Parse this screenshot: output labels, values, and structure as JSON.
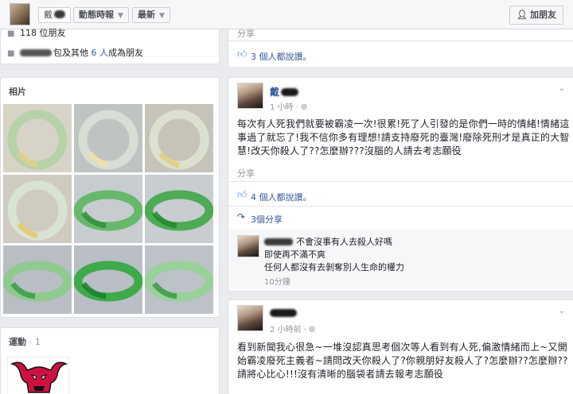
{
  "topbar": {
    "name_prefix": "戴",
    "timeline_label": "動態時報",
    "recent_label": "最新",
    "add_friend_label": "加朋友"
  },
  "friends": {
    "count_text": "118 位朋友",
    "mutual_suffix_1": "包及其他",
    "mutual_count": "6 人",
    "mutual_suffix_2": "成為朋友"
  },
  "top_post": {
    "share_label": "分享",
    "likes_count": "3",
    "likes_text": "個人都說讚。"
  },
  "photos": {
    "title": "相片",
    "tiles": [
      {
        "bg": "#d7d3c6",
        "band": "#b7d2a8",
        "accent": "#e6cf8a"
      },
      {
        "bg": "#bfc4c3",
        "band": "#d6ded6",
        "accent": "#f0e2a2"
      },
      {
        "bg": "#c6c4b8",
        "band": "#dbe0cf",
        "accent": "#e0cf7c"
      },
      {
        "bg": "#cfcbc1",
        "band": "#d9e3d3",
        "accent": "#e2c86a"
      },
      {
        "bg": "#c7ccd1",
        "band": "#67b86a",
        "accent": "#2f8f3a"
      },
      {
        "bg": "#c8cdd2",
        "band": "#4faa55",
        "accent": "#1f8a2e"
      },
      {
        "bg": "#b8bec4",
        "band": "#8fca8f",
        "accent": "#3a9d45"
      },
      {
        "bg": "#b9bfc5",
        "band": "#3eaa4a",
        "accent": "#16812a"
      },
      {
        "bg": "#bcc2c8",
        "band": "#9ad09a",
        "accent": "#3b9a46"
      }
    ]
  },
  "sports": {
    "title": "運動",
    "count": "· 1"
  },
  "post1": {
    "author_prefix": "戴",
    "time": "1 小時",
    "privacy_separator": "·",
    "text": "每次有人死我們就要被霸凌一次!很累!死了人引發的是你們一時的情緒!情緒這事過了就忘了!我不信你多有理想!請支持廢死的臺灣!廢除死刑才是真正的大智慧!改天你殺人了??怎麼辦???沒腦的人請去考志願役",
    "share_label": "分享",
    "likes_count": "4",
    "likes_text": "個人都說讚。",
    "shares_text": "3個分享",
    "comment": {
      "line1": "不會沒事有人去殺人好嗎",
      "line2": "即使再不滿不爽",
      "line3": "任何人都沒有去剝奪別人生命的權力",
      "time": "10分鐘"
    }
  },
  "post2": {
    "time": "2 小時前",
    "privacy_separator": "·",
    "text": "看到新聞我心很急~一堆沒認真思考個次等人看到有人死,偏激情緒而上~又開始霸凌廢死主義者~請問改天你殺人了?你親朋好友殺人了?怎麼辦??怎麼辦??請將心比心!!!沒有清晰的腦袋者請去報考志願役"
  }
}
